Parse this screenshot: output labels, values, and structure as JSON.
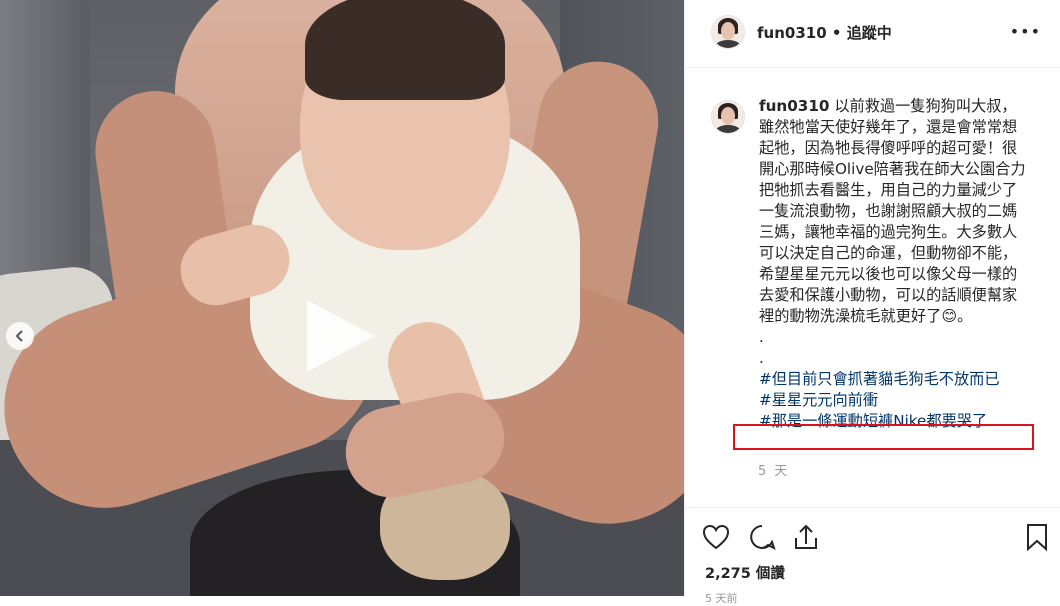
{
  "post": {
    "username": "fun0310",
    "header_separator": "•",
    "follow_label": "追蹤中",
    "more_label": "•••",
    "caption_lines": [
      "以前救過一隻狗狗叫大叔，雖然牠當天使好幾年了，還是會常常想起牠，因為牠長得傻呼呼的超可愛！很開心那時候Olive陪著我在師大公園合力把牠抓去看醫生，用自己的力量減少了一隻流浪動物，也謝謝照顧大叔的二媽三媽，讓牠幸福的過完狗生。大多數人可以決定自己的命運，但動物卻不能，希望星星元元以後也可以像父母一樣的去愛和保護小動物，可以的話順便幫家裡的動物洗澡梳毛就更好了😊。"
    ],
    "dots": [
      ".",
      "."
    ],
    "hashtags": [
      "#但目前只會抓著貓毛狗毛不放而已",
      "#星星元元向前衝",
      "#那是一條運動短褲Nike都要哭了"
    ],
    "time_ago": "5 天",
    "likes": "2,275 個讚",
    "cutoff_text": "5 天前"
  },
  "icons": {
    "play": "play-icon",
    "carousel": "carousel-prev-icon",
    "heart": "heart-icon",
    "comment": "comment-icon",
    "share": "share-icon",
    "bookmark": "bookmark-icon"
  },
  "colors": {
    "hashtag": "#003569",
    "highlight": "#d9121b",
    "text": "#262626"
  }
}
